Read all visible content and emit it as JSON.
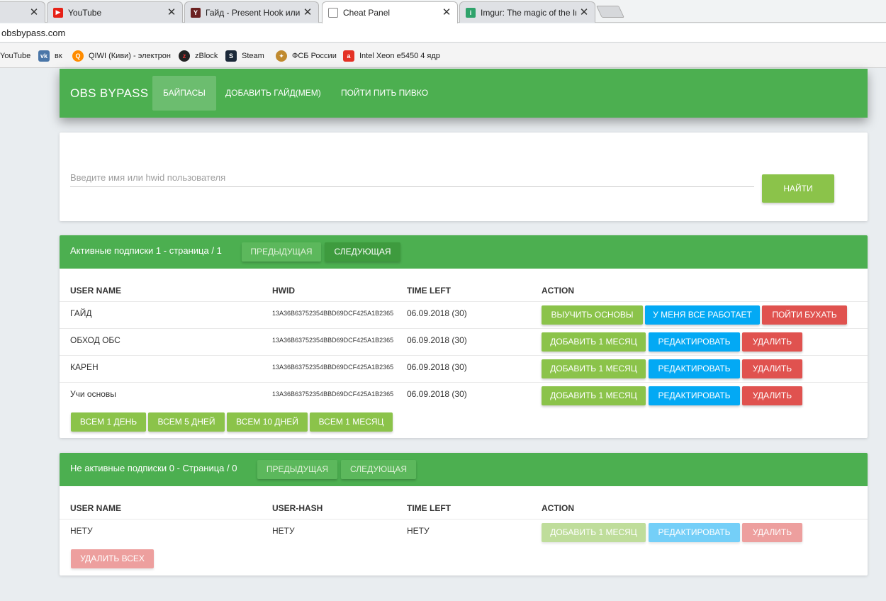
{
  "browser": {
    "tabs": [
      {
        "title": ""
      },
      {
        "title": "YouTube"
      },
      {
        "title": "Гайд - Present Hook или Об"
      },
      {
        "title": "Cheat Panel"
      },
      {
        "title": "Imgur: The magic of the Int"
      }
    ],
    "url": "obsbypass.com",
    "bookmarks": [
      "YouTube",
      "вк",
      "QIWI (Киви) - электрон",
      "zBlock",
      "Steam",
      "ФСБ России",
      "Intel Xeon e5450 4 ядр"
    ]
  },
  "navbar": {
    "brand": "OBS BYPASS",
    "links": [
      "Байпасы",
      "Добавить Гайд(мем)",
      "Пойти пить пивко"
    ]
  },
  "search": {
    "placeholder": "Введите имя или hwid пользователя",
    "button": "Найти"
  },
  "active": {
    "title": "Активные подписки 1 - страница / 1",
    "prev": "Предыдущая",
    "next": "Следующая",
    "headers": [
      "User Name",
      "HWID",
      "Time Left",
      "Action"
    ],
    "rows": [
      {
        "name": "ГАЙД",
        "hwid": "13A36B63752354BBD69DCF425A1B2365",
        "time": "06.09.2018 (30)",
        "actions": [
          "Выучить основы",
          "У меня все работает",
          "Пойти бухать"
        ]
      },
      {
        "name": "ОБХОД ОБС",
        "hwid": "13A36B63752354BBD69DCF425A1B2365",
        "time": "06.09.2018 (30)",
        "actions": [
          "Добавить 1 месяц",
          "Редактировать",
          "Удалить"
        ]
      },
      {
        "name": "КАРЕН",
        "hwid": "13A36B63752354BBD69DCF425A1B2365",
        "time": "06.09.2018 (30)",
        "actions": [
          "Добавить 1 месяц",
          "Редактировать",
          "Удалить"
        ]
      },
      {
        "name": "Учи основы",
        "hwid": "13A36B63752354BBD69DCF425A1B2365",
        "time": "06.09.2018 (30)",
        "actions": [
          "Добавить 1 месяц",
          "Редактировать",
          "Удалить"
        ]
      }
    ],
    "bulk": [
      "Всем 1 день",
      "Всем 5 дней",
      "Всем 10 дней",
      "Всем 1 месяц"
    ]
  },
  "inactive": {
    "title": "Не активные подписки 0 - Страница / 0",
    "prev": "Предыдущая",
    "next": "Следующая",
    "headers": [
      "User Name",
      "User-Hash",
      "Time Left",
      "Action"
    ],
    "row": {
      "name": "НЕТУ",
      "hash": "НЕТУ",
      "time": "НЕТУ",
      "actions": [
        "Добавить 1 месяц",
        "Редактировать",
        "Удалить"
      ]
    },
    "delete_all": "Удалить всех"
  },
  "colors": {
    "green": "#4caf50",
    "lime": "#8bc34a",
    "blue": "#03a9f4",
    "red": "#e0524f"
  }
}
